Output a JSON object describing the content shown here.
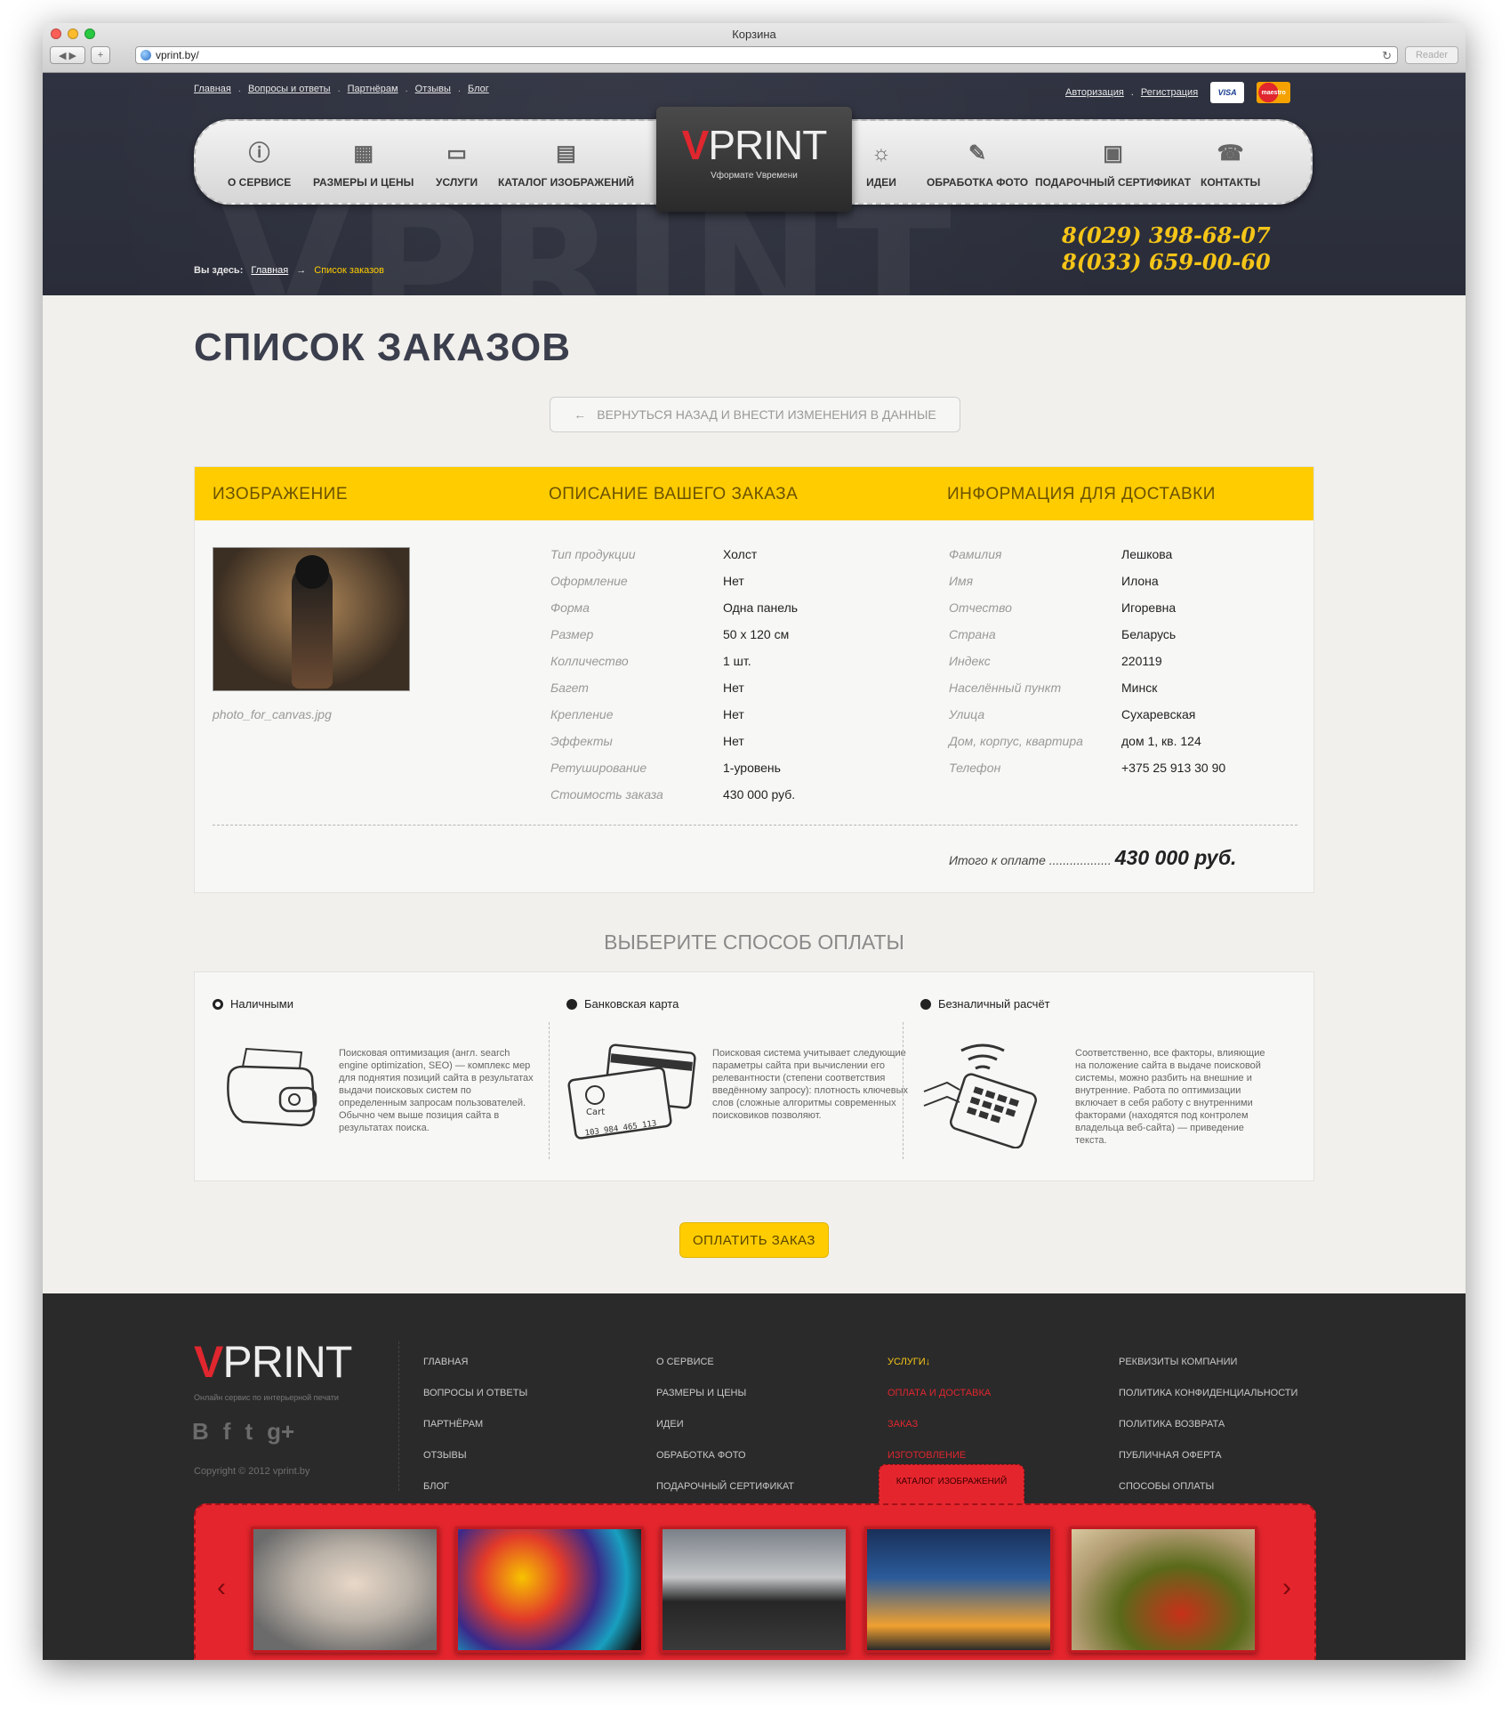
{
  "browser": {
    "title": "Корзина",
    "url": "vprint.by/",
    "reader_label": "Reader"
  },
  "header": {
    "top_nav": [
      "Главная",
      "Вопросы и ответы",
      "Партнёрам",
      "Отзывы",
      "Блог"
    ],
    "auth": {
      "login": "Авторизация",
      "register": "Регистрация"
    },
    "cards": [
      {
        "label": "VISA"
      },
      {
        "label": "maestro"
      }
    ],
    "menu_left": [
      {
        "label": "О СЕРВИСЕ",
        "icon": "info-icon"
      },
      {
        "label": "РАЗМЕРЫ И ЦЕНЫ",
        "icon": "calculator-icon"
      },
      {
        "label": "УСЛУГИ",
        "icon": "briefcase-icon"
      },
      {
        "label": "КАТАЛОГ ИЗОБРАЖЕНИЙ",
        "icon": "book-icon"
      }
    ],
    "menu_right": [
      {
        "label": "ИДЕИ",
        "icon": "lightbulb-icon"
      },
      {
        "label": "ОБРАБОТКА ФОТО",
        "icon": "eraser-icon"
      },
      {
        "label": "ПОДАРОЧНЫЙ СЕРТИФИКАТ",
        "icon": "gift-icon"
      },
      {
        "label": "КОНТАКТЫ",
        "icon": "phone-icon"
      }
    ],
    "logo": {
      "v": "V",
      "text": "PRINT",
      "slogan": "Vформате Vвремени"
    },
    "phones": [
      "8(029) 398-68-07",
      "8(033) 659-00-60"
    ],
    "breadcrumb": {
      "prefix": "Вы здесь:",
      "home": "Главная",
      "separator": "→",
      "current": "Список заказов"
    }
  },
  "page": {
    "title": "СПИСОК ЗАКАЗОВ",
    "back_button": "ВЕРНУТЬСЯ НАЗАД И ВНЕСТИ ИЗМЕНЕНИЯ В ДАННЫЕ",
    "back_arrow": "←"
  },
  "order": {
    "headers": {
      "image": "ИЗОБРАЖЕНИЕ",
      "description": "ОПИСАНИЕ ВАШЕГО ЗАКАЗА",
      "delivery": "ИНФОРМАЦИЯ ДЛЯ  ДОСТАВКИ"
    },
    "filename": "photo_for_canvas.jpg",
    "details": [
      {
        "label": "Тип продукции",
        "value": "Холст"
      },
      {
        "label": "Оформление",
        "value": "Нет"
      },
      {
        "label": "Форма",
        "value": "Одна панель"
      },
      {
        "label": "Размер",
        "value": "50 х 120 см"
      },
      {
        "label": "Колличество",
        "value": "1 шт."
      },
      {
        "label": "Багет",
        "value": "Нет"
      },
      {
        "label": "Крепление",
        "value": "Нет"
      },
      {
        "label": "Эффекты",
        "value": "Нет"
      },
      {
        "label": "Ретуширование",
        "value": "1-уровень"
      },
      {
        "label": "Стоимость заказа",
        "value": "430 000 руб."
      }
    ],
    "delivery": [
      {
        "label": "Фамилия",
        "value": "Лешкова"
      },
      {
        "label": "Имя",
        "value": "Илона"
      },
      {
        "label": "Отчество",
        "value": "Игоревна"
      },
      {
        "label": "Страна",
        "value": "Беларусь"
      },
      {
        "label": "Индекс",
        "value": "220119"
      },
      {
        "label": "Населённый пункт",
        "value": "Минск"
      },
      {
        "label": "Улица",
        "value": "Сухаревская"
      },
      {
        "label": "Дом, корпус, квартира",
        "value": "дом 1, кв. 124"
      },
      {
        "label": "Телефон",
        "value": "+375 25 913 30 90"
      }
    ],
    "total_label": "Итого к оплате ..................",
    "total_value": "430 000 руб."
  },
  "payment": {
    "title": "ВЫБЕРИТЕ СПОСОБ ОПЛАТЫ",
    "options": [
      {
        "label": "Наличными",
        "selected": true,
        "icon": "wallet-icon",
        "text": "Поисковая оптимизация (англ. search engine optimization, SEO) — комплекс мер для поднятия позиций сайта в результатах выдачи поисковых систем по определенным запросам пользователей. Обычно чем выше позиция сайта в результатах поиска."
      },
      {
        "label": "Банковская карта",
        "selected": false,
        "icon": "bank-card-icon",
        "text": "Поисковая система учитывает следующие параметры сайта при вычислении его релевантности (степени соответствия введённому запросу): плотность ключевых слов (сложные алгоритмы современных поисковиков позволяют."
      },
      {
        "label": "Безналичный расчёт",
        "selected": false,
        "icon": "contactless-terminal-icon",
        "text": "Соответственно, все факторы, влияющие на положение сайта в выдаче поисковой системы, можно разбить на внешние и внутренние. Работа по оптимизации включает в себя работу с внутренними факторами (находятся под контролем владельца веб-сайта) — приведение текста."
      }
    ],
    "card_number": "103 984 465 113",
    "card_word": "Cart",
    "pay_button": "ОПЛАТИТЬ ЗАКАЗ"
  },
  "footer": {
    "logo": {
      "v": "V",
      "text": "PRINT"
    },
    "tagline": "Онлайн сервис по интерьерной печати",
    "social": [
      "В",
      "f",
      "t",
      "g+"
    ],
    "copyright": "Copyright © 2012 vprint.by",
    "col1": [
      "ГЛАВНАЯ",
      "ВОПРОСЫ И ОТВЕТЫ",
      "ПАРТНЁРАМ",
      "ОТЗЫВЫ",
      "БЛОГ"
    ],
    "col2": [
      "О СЕРВИСЕ",
      "РАЗМЕРЫ И ЦЕНЫ",
      "ИДЕИ",
      "ОБРАБОТКА ФОТО",
      "ПОДАРОЧНЫЙ СЕРТИФИКАТ"
    ],
    "col3": [
      "УСЛУГИ↓",
      "ОПЛАТА И ДОСТАВКА",
      "ЗАКАЗ",
      "ИЗГОТОВЛЕНИЕ"
    ],
    "col4": [
      "РЕКВИЗИТЫ КОМПАНИИ",
      "ПОЛИТИКА КОНФИДЕНЦИАЛЬНОСТИ",
      "ПОЛИТИКА ВОЗВРАТА",
      "ПУБЛИЧНАЯ ОФЕРТА",
      "СПОСОБЫ ОПЛАТЫ"
    ],
    "catalog_tab": "КАТАЛОГ ИЗОБРАЖЕНИЙ",
    "gallery_prev": "‹",
    "gallery_next": "›",
    "thumbnails": [
      "portrait-photo",
      "lion-photo",
      "locomotive-photo",
      "cityscape-photo",
      "still-life-photo"
    ],
    "colors": {
      "accent_yellow": "#ffcc00",
      "brand_red": "#e0262e",
      "dark": "#2a2a2a"
    }
  }
}
